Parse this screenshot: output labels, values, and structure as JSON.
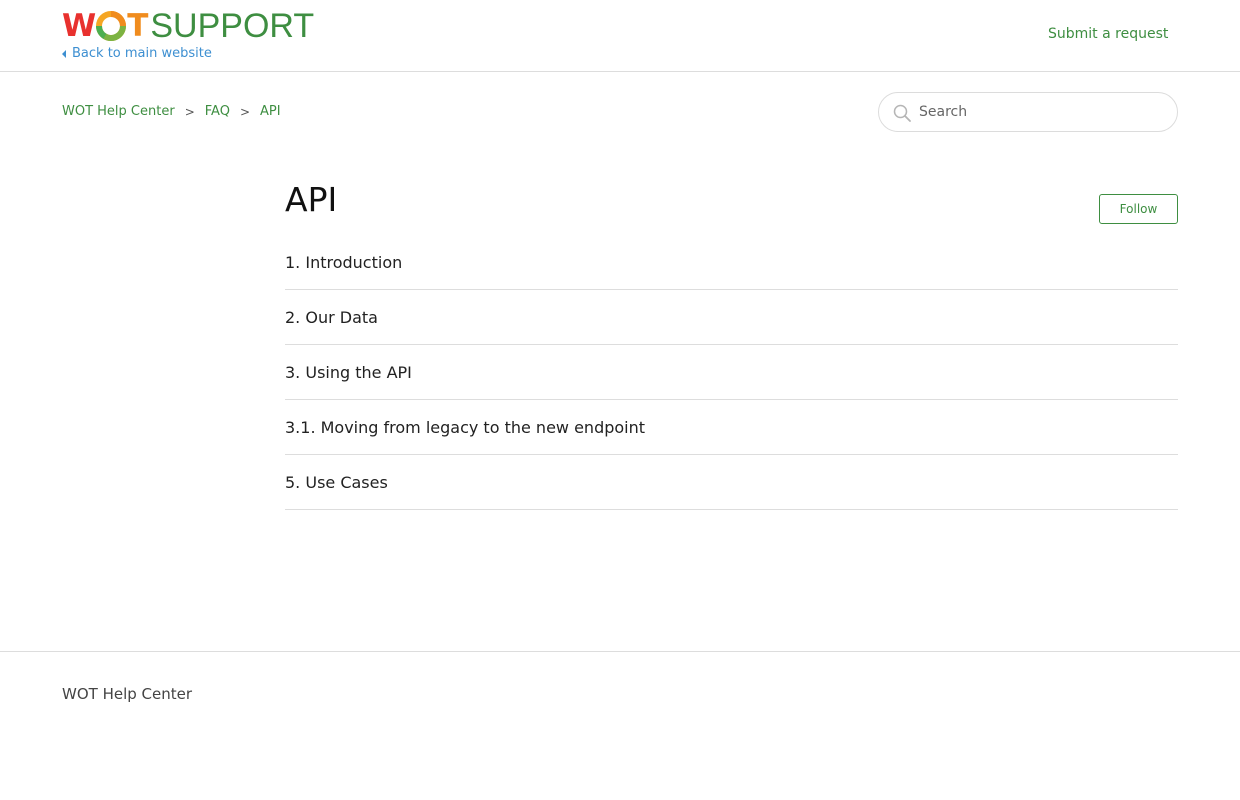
{
  "header": {
    "logo": {
      "part1": "W",
      "part2": "T",
      "part3": "SUPPORT",
      "icon": "wot-logo-icon"
    },
    "back_link": "Back to main website",
    "submit_request": "Submit a request"
  },
  "breadcrumbs": [
    {
      "label": "WOT Help Center"
    },
    {
      "label": "FAQ"
    },
    {
      "label": "API"
    }
  ],
  "breadcrumb_separator": ">",
  "search": {
    "placeholder": "Search",
    "value": ""
  },
  "section": {
    "title": "API",
    "follow_label": "Follow",
    "articles": [
      {
        "title": "1. Introduction"
      },
      {
        "title": "2. Our Data"
      },
      {
        "title": "3. Using the API"
      },
      {
        "title": "3.1. Moving from legacy to the new endpoint"
      },
      {
        "title": "5. Use Cases"
      }
    ]
  },
  "footer": {
    "text": "WOT Help Center"
  },
  "colors": {
    "brand_green": "#3e8e41",
    "brand_red": "#e8312e",
    "brand_orange": "#f08c1e",
    "link_blue": "#3d8fd1"
  }
}
